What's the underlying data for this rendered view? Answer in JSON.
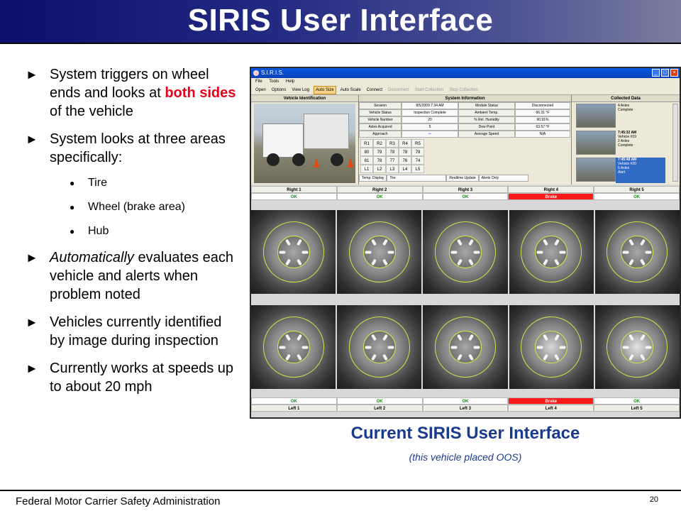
{
  "slide": {
    "title": "SIRIS User Interface",
    "bullets": [
      {
        "before": "System triggers on wheel ends and looks at ",
        "highlight": "both sides",
        "after": " of the vehicle"
      },
      {
        "text": "System looks at three areas specifically:"
      },
      {
        "italic": "Automatically",
        "text": " evaluates each vehicle and alerts when problem noted"
      },
      {
        "text": "Vehicles currently identified by image during inspection"
      },
      {
        "text": "Currently works at speeds up to about 20 mph"
      }
    ],
    "sub_items": [
      "Tire",
      "Wheel (brake area)",
      "Hub"
    ],
    "caption": "Current SIRIS User Interface",
    "caption_sub": "(this vehicle placed OOS)",
    "footer": "Federal Motor Carrier Safety Administration",
    "page_number": "20"
  },
  "app": {
    "window_title": "S.I.R.I.S.",
    "menu": [
      "File",
      "Tools",
      "Help"
    ],
    "toolbar": [
      "Open",
      "Options",
      "View Log",
      "Auto Size",
      "Auto Scale",
      "Connect",
      "Disconnect",
      "Start Collection",
      "Stop Collection"
    ],
    "panels": {
      "vehicle": "Vehicle Identification",
      "system": "System Information",
      "collected": "Collected Data"
    },
    "info_rows": [
      [
        "Session",
        "8/5/2009 7:34 AM",
        "Module Status",
        "Disconnected"
      ],
      [
        "Vehicle Status",
        "Inspection Complete",
        "Ambient Temp.",
        "66.31 °F"
      ],
      [
        "Vehicle Number",
        "20",
        "% Rel. Humidity",
        "90.91%"
      ],
      [
        "Axles Acquired",
        "5",
        "Dew Point",
        "63.57 °F"
      ],
      [
        "Approach",
        "⇐",
        "Average Speed",
        "N/A"
      ]
    ],
    "r_labels": [
      "R1",
      "R2",
      "R3",
      "R4",
      "R5"
    ],
    "r_values": [
      "80",
      "79",
      "78",
      "78",
      "79"
    ],
    "l_values": [
      "81",
      "78",
      "77",
      "76",
      "74"
    ],
    "l_labels": [
      "L1",
      "L2",
      "L3",
      "L4",
      "L5"
    ],
    "temp_display_label": "Temp. Display",
    "temp_display_value": "Tire",
    "realtime_label": "Realtime Update",
    "realtime_value": "Alerts Only",
    "collected_items": [
      {
        "time": "",
        "vehicle": "4 Axles",
        "axles": "",
        "status": "Complete"
      },
      {
        "time": "7:45:32 AM",
        "vehicle": "Vehicle #19",
        "axles": "2 Axles",
        "status": "Complete"
      },
      {
        "time": "7:45:48 AM",
        "vehicle": "Vehicle #20",
        "axles": "5 Axles",
        "status": "Alert"
      }
    ],
    "right_labels": [
      "Right 1",
      "Right 2",
      "Right 3",
      "Right 4",
      "Right 5"
    ],
    "right_status": [
      "OK",
      "OK",
      "OK",
      "Brake",
      "OK"
    ],
    "left_status": [
      "OK",
      "OK",
      "OK",
      "Brake",
      "OK"
    ],
    "left_labels": [
      "Left 1",
      "Left 2",
      "Left 3",
      "Left 4",
      "Left 5"
    ],
    "colors": {
      "ok": "#1a8a1a",
      "alert": "#ff1a1a",
      "caption": "#1a3a8c",
      "highlight": "#e8001c"
    }
  }
}
